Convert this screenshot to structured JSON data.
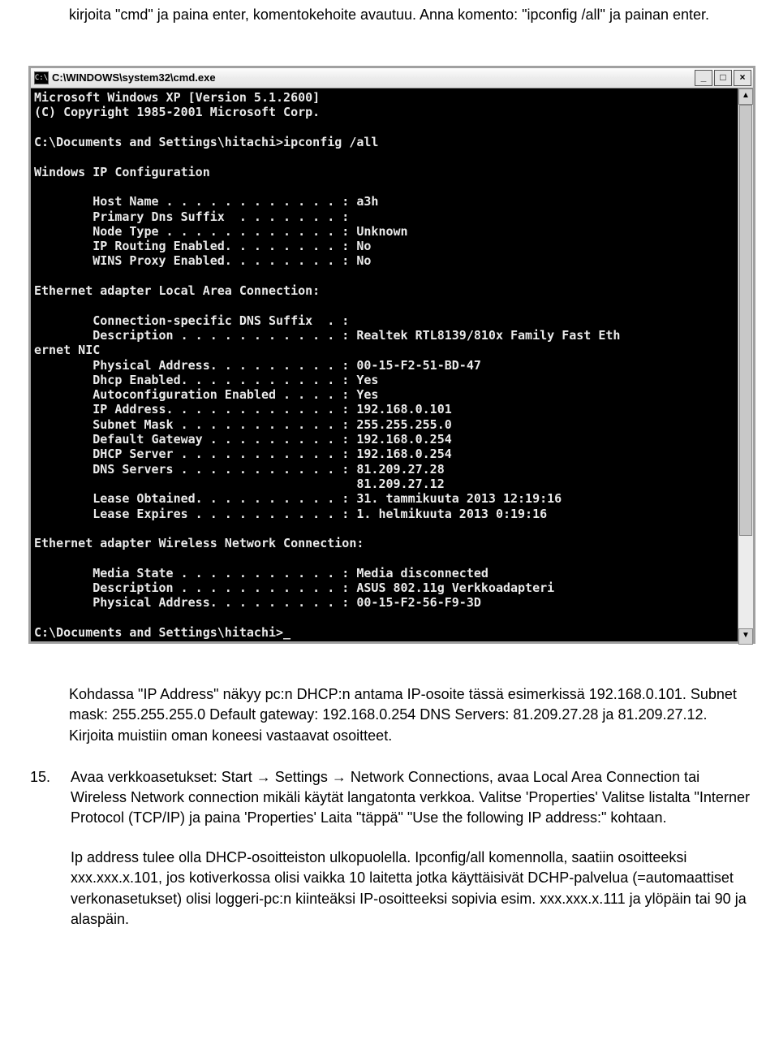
{
  "intro_text": "kirjoita \"cmd\" ja paina enter, komentokehoite avautuu. Anna komento: \"ipconfig /all\" ja painan enter.",
  "cmd_window": {
    "title": "C:\\WINDOWS\\system32\\cmd.exe",
    "icon_label": "C:\\",
    "min_label": "_",
    "max_label": "□",
    "close_label": "×",
    "console_text": "Microsoft Windows XP [Version 5.1.2600]\n(C) Copyright 1985-2001 Microsoft Corp.\n\nC:\\Documents and Settings\\hitachi>ipconfig /all\n\nWindows IP Configuration\n\n        Host Name . . . . . . . . . . . . : a3h\n        Primary Dns Suffix  . . . . . . . :\n        Node Type . . . . . . . . . . . . : Unknown\n        IP Routing Enabled. . . . . . . . : No\n        WINS Proxy Enabled. . . . . . . . : No\n\nEthernet adapter Local Area Connection:\n\n        Connection-specific DNS Suffix  . :\n        Description . . . . . . . . . . . : Realtek RTL8139/810x Family Fast Eth\nernet NIC\n        Physical Address. . . . . . . . . : 00-15-F2-51-BD-47\n        Dhcp Enabled. . . . . . . . . . . : Yes\n        Autoconfiguration Enabled . . . . : Yes\n        IP Address. . . . . . . . . . . . : 192.168.0.101\n        Subnet Mask . . . . . . . . . . . : 255.255.255.0\n        Default Gateway . . . . . . . . . : 192.168.0.254\n        DHCP Server . . . . . . . . . . . : 192.168.0.254\n        DNS Servers . . . . . . . . . . . : 81.209.27.28\n                                            81.209.27.12\n        Lease Obtained. . . . . . . . . . : 31. tammikuuta 2013 12:19:16\n        Lease Expires . . . . . . . . . . : 1. helmikuuta 2013 0:19:16\n\nEthernet adapter Wireless Network Connection:\n\n        Media State . . . . . . . . . . . : Media disconnected\n        Description . . . . . . . . . . . : ASUS 802.11g Verkkoadapteri\n        Physical Address. . . . . . . . . : 00-15-F2-56-F9-3D\n\nC:\\Documents and Settings\\hitachi>_"
  },
  "explain_text": "Kohdassa \"IP Address\" näkyy pc:n DHCP:n antama IP-osoite tässä esimerkissä 192.168.0.101. Subnet mask: 255.255.255.0 Default gateway: 192.168.0.254 DNS Servers: 81.209.27.28 ja 81.209.27.12. Kirjoita muistiin oman koneesi vastaavat osoitteet.",
  "step15": {
    "num": "15.",
    "para1": "Avaa verkkoasetukset: Start → Settings → Network Connections, avaa Local Area Connection tai Wireless Network connection mikäli käytät langatonta verkkoa. Valitse 'Properties' Valitse listalta \"Interner Protocol (TCP/IP) ja paina 'Properties' Laita \"täppä\" \"Use the following IP address:\" kohtaan.",
    "para2": "Ip address tulee olla DHCP-osoitteiston ulkopuolella. Ipconfig/all komennolla, saatiin osoitteeksi xxx.xxx.x.101, jos kotiverkossa olisi vaikka 10 laitetta jotka käyttäisivät DCHP-palvelua (=automaattiset verkonasetukset) olisi loggeri-pc:n kiinteäksi IP-osoitteeksi sopivia esim. xxx.xxx.x.111 ja ylöpäin tai 90 ja alaspäin."
  }
}
